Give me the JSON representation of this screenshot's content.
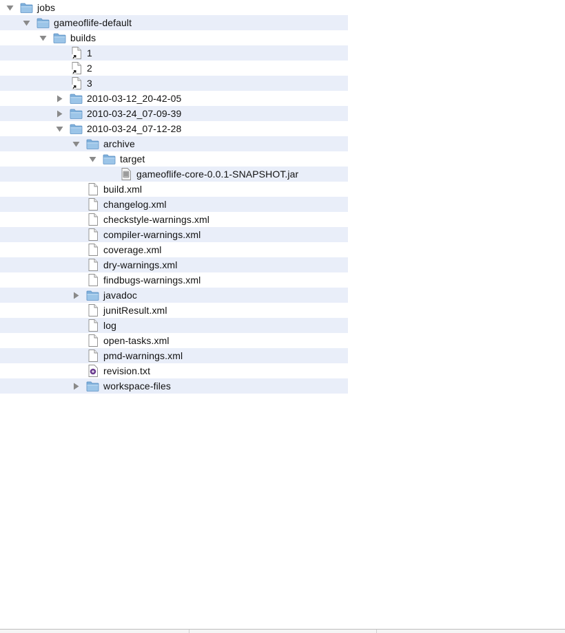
{
  "colors": {
    "row_stripe": "#e9eef9",
    "folder": "#7fb0db",
    "folder_dark": "#5b8fc3",
    "triangle": "#8a8a8a"
  },
  "tree": [
    {
      "label": "jobs",
      "depth": 0,
      "type": "folder",
      "state": "expanded"
    },
    {
      "label": "gameoflife-default",
      "depth": 1,
      "type": "folder",
      "state": "expanded"
    },
    {
      "label": "builds",
      "depth": 2,
      "type": "folder",
      "state": "expanded"
    },
    {
      "label": "1",
      "depth": 3,
      "type": "alias",
      "state": "none"
    },
    {
      "label": "2",
      "depth": 3,
      "type": "alias",
      "state": "none"
    },
    {
      "label": "3",
      "depth": 3,
      "type": "alias",
      "state": "none"
    },
    {
      "label": "2010-03-12_20-42-05",
      "depth": 3,
      "type": "folder",
      "state": "collapsed"
    },
    {
      "label": "2010-03-24_07-09-39",
      "depth": 3,
      "type": "folder",
      "state": "collapsed"
    },
    {
      "label": "2010-03-24_07-12-28",
      "depth": 3,
      "type": "folder",
      "state": "expanded"
    },
    {
      "label": "archive",
      "depth": 4,
      "type": "folder",
      "state": "expanded"
    },
    {
      "label": "target",
      "depth": 5,
      "type": "folder",
      "state": "expanded"
    },
    {
      "label": "gameoflife-core-0.0.1-SNAPSHOT.jar",
      "depth": 6,
      "type": "jar",
      "state": "none"
    },
    {
      "label": "build.xml",
      "depth": 4,
      "type": "file",
      "state": "none"
    },
    {
      "label": "changelog.xml",
      "depth": 4,
      "type": "file",
      "state": "none"
    },
    {
      "label": "checkstyle-warnings.xml",
      "depth": 4,
      "type": "file",
      "state": "none"
    },
    {
      "label": "compiler-warnings.xml",
      "depth": 4,
      "type": "file",
      "state": "none"
    },
    {
      "label": "coverage.xml",
      "depth": 4,
      "type": "file",
      "state": "none"
    },
    {
      "label": "dry-warnings.xml",
      "depth": 4,
      "type": "file",
      "state": "none"
    },
    {
      "label": "findbugs-warnings.xml",
      "depth": 4,
      "type": "file",
      "state": "none"
    },
    {
      "label": "javadoc",
      "depth": 4,
      "type": "folder",
      "state": "collapsed"
    },
    {
      "label": "junitResult.xml",
      "depth": 4,
      "type": "file",
      "state": "none"
    },
    {
      "label": "log",
      "depth": 4,
      "type": "file",
      "state": "none"
    },
    {
      "label": "open-tasks.xml",
      "depth": 4,
      "type": "file",
      "state": "none"
    },
    {
      "label": "pmd-warnings.xml",
      "depth": 4,
      "type": "file",
      "state": "none"
    },
    {
      "label": "revision.txt",
      "depth": 4,
      "type": "text",
      "state": "none"
    },
    {
      "label": "workspace-files",
      "depth": 4,
      "type": "folder",
      "state": "collapsed"
    }
  ]
}
